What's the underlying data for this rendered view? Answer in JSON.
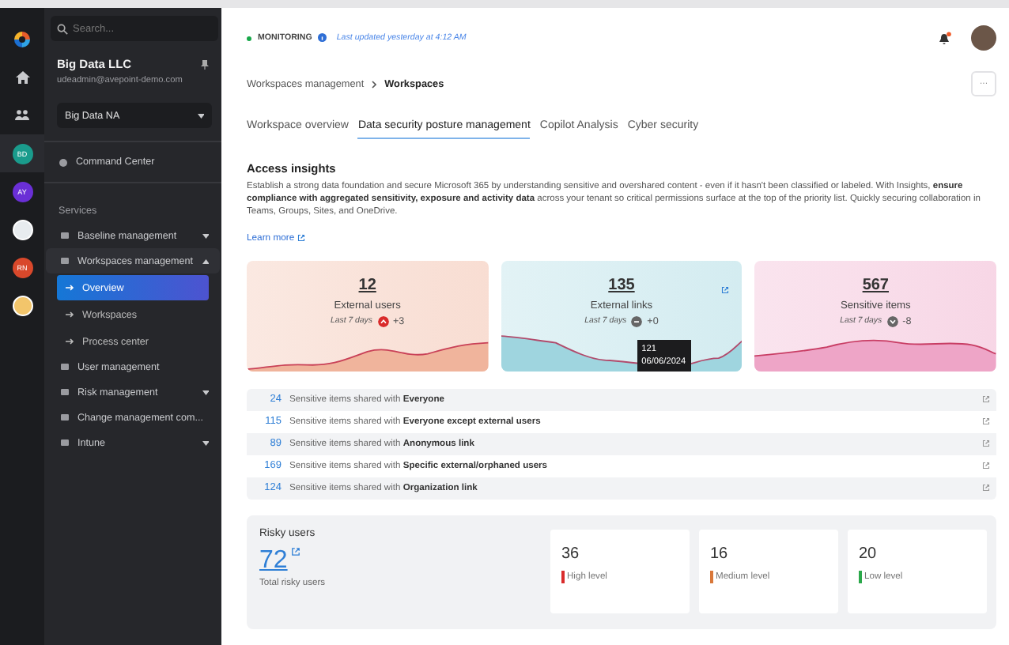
{
  "rail": {
    "avatars": [
      {
        "kind": "initials",
        "label": "BD",
        "color": "#1a9b8c",
        "selected": true
      },
      {
        "kind": "initials",
        "label": "AY",
        "color": "#6a2fd6",
        "selected": false
      },
      {
        "kind": "image",
        "color": "#e8ecef",
        "selected": false
      },
      {
        "kind": "initials",
        "label": "RN",
        "color": "#d9482b",
        "selected": false
      },
      {
        "kind": "image",
        "color": "#f2c56b",
        "selected": false
      }
    ]
  },
  "sidebar": {
    "search": {
      "placeholder": "Search..."
    },
    "org": {
      "name": "Big Data LLC",
      "email": "udeadmin@avepoint-demo.com"
    },
    "tenant": {
      "value": "Big Data NA"
    },
    "command_center": "Command Center",
    "section": "Services",
    "items": [
      {
        "label": "Baseline management",
        "expanded": false,
        "selected": false
      },
      {
        "label": "Workspaces management",
        "expanded": true,
        "selected": false,
        "children": [
          {
            "label": "Overview",
            "selected": true
          },
          {
            "label": "Workspaces",
            "selected": false
          },
          {
            "label": "Process center",
            "selected": false
          }
        ]
      },
      {
        "label": "User management",
        "selected": false
      },
      {
        "label": "Risk management",
        "expanded": false,
        "selected": false
      },
      {
        "label": "Change management com...",
        "selected": false
      },
      {
        "label": "Intune",
        "expanded": false,
        "selected": false
      }
    ]
  },
  "header": {
    "status": "MONITORING",
    "updated": "Last updated yesterday at 4:12 AM",
    "notification": true
  },
  "breadcrumb": [
    "Workspaces management",
    "Workspaces"
  ],
  "more_button": "···",
  "tabs": [
    {
      "label": "Workspace overview",
      "selected": false
    },
    {
      "label": "Data security posture management",
      "selected": true
    },
    {
      "label": "Copilot Analysis",
      "selected": false
    },
    {
      "label": "Cyber security",
      "selected": false
    }
  ],
  "insights": {
    "title": "Access insights",
    "text": "Establish a strong data foundation and secure Microsoft 365 by understanding sensitive and overshared content - even if it hasn't been classified or labeled. With Insights, **ensure compliance with aggregated sensitivity, exposure and activity data** across your tenant so critical permissions surface at the top of the priority list. Quickly securing collaboration in Teams, Groups, Sites, and OneDrive.",
    "link": "Learn more"
  },
  "cards": [
    {
      "value": "12",
      "label": "External users",
      "period": "Last 7 days",
      "kind": "up",
      "delta": "+3",
      "color": "#f0b49c",
      "external_link": false
    },
    {
      "value": "135",
      "label": "External links",
      "period": "Last 7 days",
      "kind": "flat",
      "delta": "+0",
      "color": "#9fd5df",
      "external_link": true,
      "tooltip": {
        "value": "121",
        "date": "06/06/2024"
      }
    },
    {
      "value": "567",
      "label": "Sensitive items",
      "period": "Last 7 days",
      "kind": "down",
      "delta": "-8",
      "color": "#eea5c7",
      "external_link": false
    }
  ],
  "shared": [
    {
      "count": "24",
      "text": "Sensitive items shared with **Everyone**"
    },
    {
      "count": "115",
      "text": "Sensitive items shared with **Everyone except external users**"
    },
    {
      "count": "89",
      "text": "Sensitive items shared with **Anonymous link**"
    },
    {
      "count": "169",
      "text": "Sensitive items shared with **Specific external/orphaned users**"
    },
    {
      "count": "124",
      "text": "Sensitive items shared with **Organization link**"
    }
  ],
  "risky_users": {
    "title": "Risky users",
    "total": "72",
    "caption": "Total risky users",
    "levels": [
      {
        "value": "36",
        "label": "High level",
        "color": "#d92b2b"
      },
      {
        "value": "16",
        "label": "Medium level",
        "color": "#d9783a"
      },
      {
        "value": "20",
        "label": "Low level",
        "color": "#2ba84a"
      }
    ]
  }
}
